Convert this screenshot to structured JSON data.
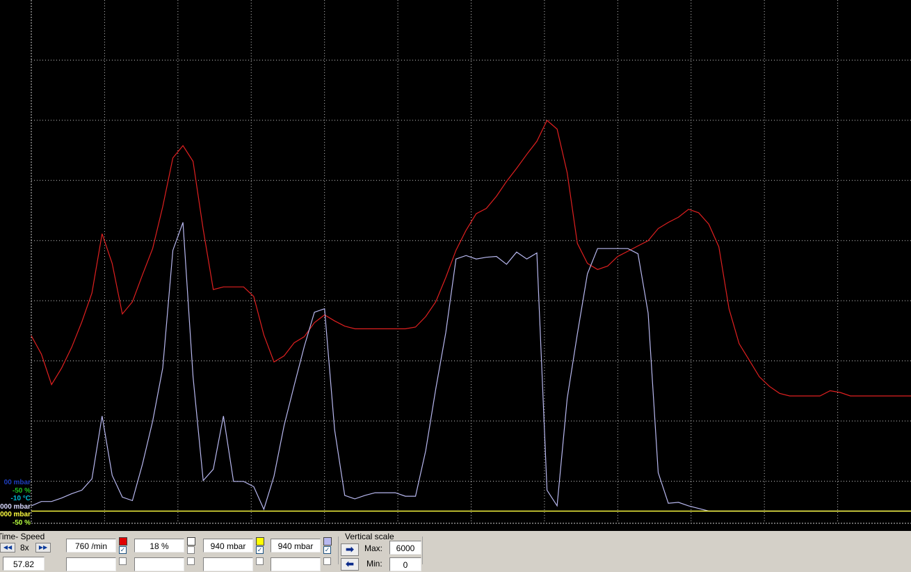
{
  "axis_labels": [
    {
      "text": "00 mbar",
      "color": "#1f3fbf"
    },
    {
      "text": "-50 %",
      "color": "#22c022"
    },
    {
      "text": "-10 °C",
      "color": "#00bcd4"
    },
    {
      "text": "000 mbar",
      "color": "#d8d8ff"
    },
    {
      "text": "000 mbar",
      "color": "#ffff40"
    },
    {
      "text": "-50 %",
      "color": "#b8ff40"
    }
  ],
  "controls": {
    "time_speed_label": "Time- Speed",
    "speed_value": "8x",
    "rewind_icon": "rewind-icon",
    "forward_icon": "fast-forward-icon",
    "time_value": "57.82",
    "fields": [
      {
        "value": "760 /min",
        "color": "#e00000",
        "checked": true
      },
      {
        "value": "18 %",
        "color": "#ffffff",
        "checked": false
      },
      {
        "value": "940 mbar",
        "color": "#ffff00",
        "checked": true
      },
      {
        "value": "940 mbar",
        "color": "#b8b8f0",
        "checked": true
      }
    ],
    "vertical_scale_label": "Vertical scale",
    "max_label": "Max:",
    "max_value": "6000",
    "min_label": "Min:",
    "min_value": "0"
  },
  "chart_data": {
    "type": "line",
    "background": "#000000",
    "grid": true,
    "series": [
      {
        "color": "#e02020",
        "x": [
          0,
          1,
          2,
          3,
          4,
          5,
          6,
          7,
          8,
          9,
          10,
          11,
          12,
          13,
          14,
          15,
          16,
          17,
          18,
          19,
          20,
          21,
          22,
          23,
          24,
          25,
          26,
          27,
          28,
          29,
          30,
          31,
          32,
          33,
          34,
          35,
          36,
          37,
          38,
          39,
          40,
          41,
          42,
          43,
          44,
          45,
          46,
          47,
          48,
          49,
          50,
          51,
          52,
          53,
          54,
          55,
          56,
          57,
          58,
          59,
          60,
          61,
          62,
          63,
          64,
          65,
          66,
          67,
          68,
          69,
          70,
          71,
          72,
          73,
          74,
          75,
          76,
          77,
          78,
          79,
          80,
          81,
          82,
          83,
          84,
          85,
          86,
          87
        ],
        "y": [
          2150,
          1940,
          1590,
          1780,
          2020,
          2310,
          2640,
          3320,
          2980,
          2400,
          2540,
          2850,
          3150,
          3630,
          4190,
          4330,
          4150,
          3370,
          2680,
          2710,
          2710,
          2710,
          2600,
          2160,
          1850,
          1920,
          2070,
          2140,
          2300,
          2390,
          2320,
          2260,
          2230,
          2230,
          2230,
          2230,
          2230,
          2230,
          2250,
          2370,
          2540,
          2820,
          3130,
          3360,
          3550,
          3610,
          3750,
          3920,
          4070,
          4230,
          4380,
          4620,
          4520,
          4020,
          3210,
          2980,
          2910,
          2950,
          3060,
          3120,
          3180,
          3240,
          3380,
          3450,
          3510,
          3600,
          3560,
          3430,
          3170,
          2460,
          2060,
          1870,
          1680,
          1570,
          1490,
          1460,
          1460,
          1460,
          1460,
          1520,
          1500,
          1460,
          1460,
          1460,
          1460,
          1460,
          1460,
          1460
        ]
      },
      {
        "color": "#ffff40",
        "x": [
          0,
          1,
          2,
          3,
          4,
          5,
          6,
          7,
          8,
          9,
          10,
          11,
          12,
          13,
          14,
          15,
          16,
          17,
          18,
          19,
          20,
          21,
          22,
          23,
          24,
          25,
          26,
          27,
          28,
          29,
          30,
          31,
          32,
          33,
          34,
          35,
          36,
          37,
          38,
          39,
          40,
          41,
          42,
          43,
          44,
          45,
          46,
          47,
          48,
          49,
          50,
          51,
          52,
          53,
          54,
          55,
          56,
          57,
          58,
          59,
          60,
          61,
          62,
          63,
          64,
          65,
          66,
          67,
          68,
          69,
          70,
          71,
          72,
          73,
          74,
          75,
          76,
          77,
          78,
          79,
          80,
          81,
          82,
          83,
          84,
          85,
          86,
          87
        ],
        "y": [
          140,
          140,
          140,
          140,
          140,
          140,
          140,
          140,
          140,
          140,
          140,
          140,
          140,
          140,
          140,
          140,
          140,
          140,
          140,
          140,
          140,
          140,
          140,
          140,
          140,
          140,
          140,
          140,
          140,
          140,
          140,
          140,
          140,
          140,
          140,
          140,
          140,
          140,
          140,
          140,
          140,
          140,
          140,
          140,
          140,
          140,
          140,
          140,
          140,
          140,
          140,
          140,
          140,
          140,
          140,
          140,
          140,
          140,
          140,
          140,
          140,
          140,
          140,
          140,
          140,
          140,
          140,
          140,
          140,
          140,
          140,
          140,
          140,
          140,
          140,
          140,
          140,
          140,
          140,
          140,
          140,
          140,
          140,
          140,
          140,
          140,
          140,
          140
        ]
      },
      {
        "color": "#b8b8f0",
        "x": [
          0,
          1,
          2,
          3,
          4,
          5,
          6,
          7,
          8,
          9,
          10,
          11,
          12,
          13,
          14,
          15,
          16,
          17,
          18,
          19,
          20,
          21,
          22,
          23,
          24,
          25,
          26,
          27,
          28,
          29,
          30,
          31,
          32,
          33,
          34,
          35,
          36,
          37,
          38,
          39,
          40,
          41,
          42,
          43,
          44,
          45,
          46,
          47,
          48,
          49,
          50,
          51,
          52,
          53,
          54,
          55,
          56,
          57,
          58,
          59,
          60,
          61,
          62,
          63,
          64,
          65,
          66,
          67,
          68,
          69,
          70,
          71,
          72,
          73,
          74,
          75,
          76,
          77,
          78,
          79,
          80,
          81,
          82,
          83,
          84,
          85,
          86,
          87
        ],
        "y": [
          200,
          250,
          250,
          290,
          340,
          380,
          510,
          1230,
          550,
          300,
          260,
          680,
          1170,
          1780,
          3130,
          3450,
          1680,
          490,
          620,
          1230,
          480,
          480,
          420,
          160,
          540,
          1120,
          1580,
          2030,
          2420,
          2460,
          1070,
          320,
          280,
          320,
          350,
          350,
          350,
          310,
          310,
          830,
          1540,
          2190,
          3030,
          3070,
          3030,
          3050,
          3060,
          2970,
          3110,
          3030,
          3100,
          380,
          200,
          1430,
          2170,
          2860,
          3150,
          3150,
          3150,
          3150,
          3090,
          2410,
          580,
          230,
          240,
          200,
          170,
          140,
          140,
          140,
          140,
          140,
          140,
          140,
          140,
          140,
          140,
          140,
          140,
          140,
          140,
          140,
          140,
          140,
          140,
          140,
          140,
          140
        ]
      },
      {
        "color": "#ffff40",
        "x": [
          0,
          1,
          2,
          3,
          4,
          5,
          6,
          7,
          8,
          9,
          10,
          11,
          12,
          13,
          14,
          15,
          16,
          17,
          18,
          19,
          20,
          21,
          22,
          23,
          24,
          25,
          26,
          27,
          28,
          29,
          30,
          31,
          32,
          33,
          34,
          35,
          36,
          37,
          38,
          39,
          40,
          41,
          42,
          43,
          44,
          45,
          46,
          47,
          48,
          49,
          50,
          51,
          52,
          53,
          54,
          55,
          56,
          57,
          58,
          59,
          60,
          61,
          62,
          63,
          64,
          65,
          66,
          67,
          68,
          69,
          70,
          71,
          72,
          73,
          74,
          75,
          76,
          77,
          78,
          79,
          80,
          81,
          82,
          83,
          84,
          85,
          86,
          87
        ],
        "y": [
          140,
          140,
          140,
          140,
          140,
          140,
          140,
          140,
          140,
          140,
          140,
          140,
          140,
          140,
          140,
          140,
          140,
          140,
          140,
          140,
          140,
          140,
          140,
          140,
          140,
          140,
          140,
          140,
          140,
          140,
          140,
          140,
          140,
          140,
          140,
          140,
          140,
          140,
          140,
          140,
          140,
          140,
          140,
          140,
          140,
          140,
          140,
          140,
          140,
          140,
          140,
          140,
          140,
          140,
          140,
          140,
          140,
          140,
          140,
          140,
          140,
          140,
          140,
          140,
          140,
          140,
          140,
          140,
          140,
          140,
          140,
          140,
          140,
          140,
          140,
          140,
          140,
          140,
          140,
          140,
          140,
          140,
          140,
          140,
          140,
          140,
          140,
          140
        ]
      }
    ],
    "ylim": [
      0,
      6000
    ]
  }
}
